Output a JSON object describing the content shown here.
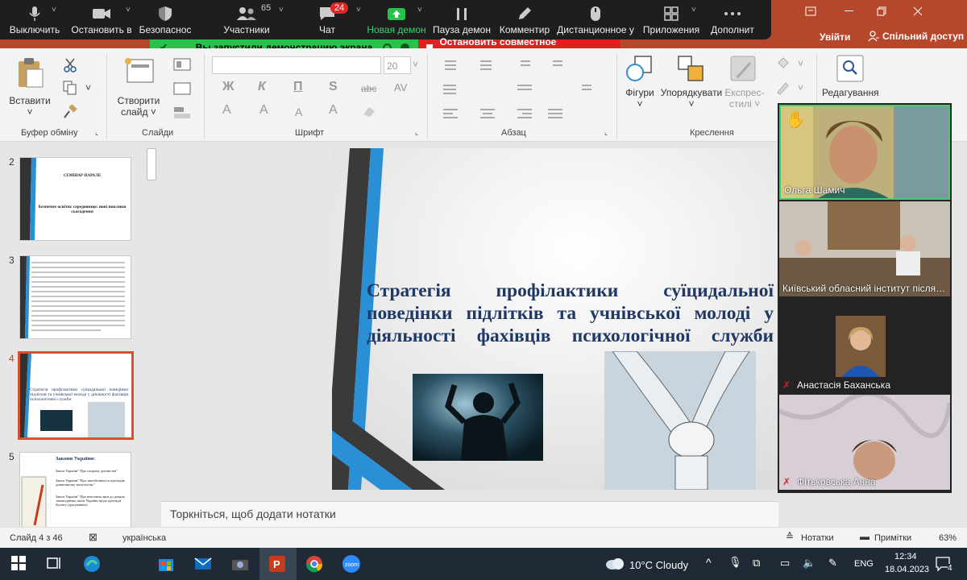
{
  "zoom_toolbar": {
    "mute_label": "Выключить",
    "stop_video_label": "Остановить в",
    "security_label": "Безопаснос",
    "participants_label": "Участники",
    "participants_count": "65",
    "chat_label": "Чат",
    "chat_badge": "24",
    "new_share_label": "Новая демон",
    "pause_share_label": "Пауза демон",
    "annotate_label": "Комментир",
    "remote_control_label": "Дистанционное у",
    "apps_label": "Приложения",
    "more_label": "Дополнит"
  },
  "share_banner": {
    "sharing_text": "Вы запустили демонстрацию экрана",
    "stop_text": "Остановить совместное использование"
  },
  "title_bar": {
    "signin_label": "Увійти",
    "share_label": "Спільний доступ"
  },
  "ribbon": {
    "paste_label": "Вставити",
    "clipboard_group": "Буфер обміну",
    "new_slide_label": "Створити",
    "new_slide_label2": "слайд",
    "slides_group": "Слайди",
    "font_size": "20",
    "bold": "Ж",
    "italic": "К",
    "underline": "П",
    "shadow": "S",
    "strike": "abc",
    "spacing": "AV",
    "font_color": "A",
    "grow": "A",
    "shrink": "A",
    "clear": "A",
    "font_group": "Шрифт",
    "paragraph_group": "Абзац",
    "shapes_label": "Фігури",
    "arrange_label": "Упорядкувати",
    "quick_styles_label": "Експрес-",
    "quick_styles_label2": "стилі",
    "drawing_group": "Креслення",
    "editing_label": "Редагування"
  },
  "thumbnails": [
    {
      "num": "2",
      "title": "СЕМІНАР-ПАРАЛЕ",
      "subtitle": "Безпечне освітнє середовище: нові виклики сьогодення"
    },
    {
      "num": "3"
    },
    {
      "num": "4",
      "text": "Стратегія профілактики суїцидальної поведінки підлітків та учнівської молоді у діяльності фахівців психологічної служби"
    },
    {
      "num": "5",
      "title": "Закони України:",
      "items": [
        "Закон України\" Про охорону дитинства\"",
        "Закон України\" Про запобігання та протидію домашньому насильству\"",
        "Закон України\" Про внесення змін до деяких законодавчих актів України щодо протидії булінгу (цькуванню)."
      ]
    }
  ],
  "slide": {
    "title": "Стратегія профілактики суїцидальної поведінки підлітків та учнівської молоді у діяльності фахівців психологічної служби"
  },
  "notes_placeholder": "Торкніться, щоб додати нотатки",
  "participants": [
    {
      "name": "Ольга Шамич"
    },
    {
      "name": "Київський обласний інститут післяд..."
    },
    {
      "name": "Анастасія Баханська"
    },
    {
      "name": "Фітьковська Анна"
    }
  ],
  "status": {
    "slide_info": "Слайд 4 з 46",
    "language": "українська",
    "notes_label": "Нотатки",
    "comments_label": "Примітки",
    "zoom": "63%"
  },
  "taskbar": {
    "weather": "10°C  Cloudy",
    "lang": "ENG",
    "time": "12:34",
    "date": "18.04.2023",
    "notif_count": "4"
  },
  "colors": {
    "zoom_bg": "#1e1e1e",
    "ppt_accent": "#b7472a",
    "share_green": "#27c24c",
    "stop_red": "#e02020",
    "title_blue": "#1f3864"
  }
}
